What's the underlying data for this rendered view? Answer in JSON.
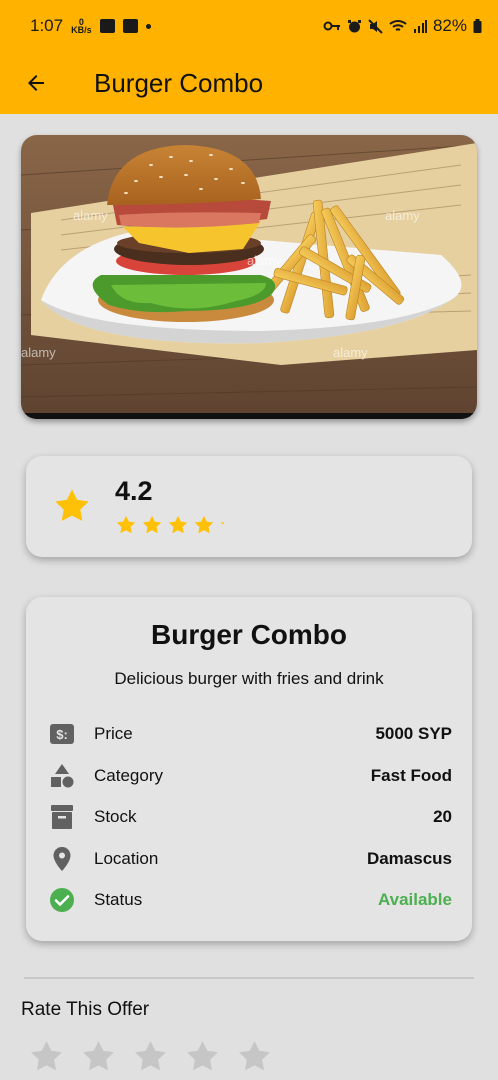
{
  "status_bar": {
    "time": "1:07",
    "net_speed_value": "0",
    "net_speed_unit": "KB/s",
    "battery": "82%"
  },
  "app_bar": {
    "title": "Burger Combo",
    "back_icon": "arrow-left-icon"
  },
  "hero_image": {
    "watermark": "alamy"
  },
  "rating": {
    "value": "4.2",
    "stars": 4.2,
    "star_color": "#ffc107"
  },
  "product": {
    "name": "Burger Combo",
    "description": "Delicious burger with fries and drink",
    "details": [
      {
        "icon": "money-icon",
        "label": "Price",
        "value": "5000 SYP"
      },
      {
        "icon": "category-icon",
        "label": "Category",
        "value": "Fast Food"
      },
      {
        "icon": "inventory-box-icon",
        "label": "Stock",
        "value": "20"
      },
      {
        "icon": "location-pin-icon",
        "label": "Location",
        "value": "Damascus"
      },
      {
        "icon": "check-circle-icon",
        "label": "Status",
        "value": "Available"
      }
    ]
  },
  "rate_section": {
    "title": "Rate This Offer",
    "stars": 5
  },
  "colors": {
    "accent": "#ffb300",
    "available": "#4caf50",
    "icon_gray": "#616161",
    "star_empty": "#c6c6c6"
  }
}
